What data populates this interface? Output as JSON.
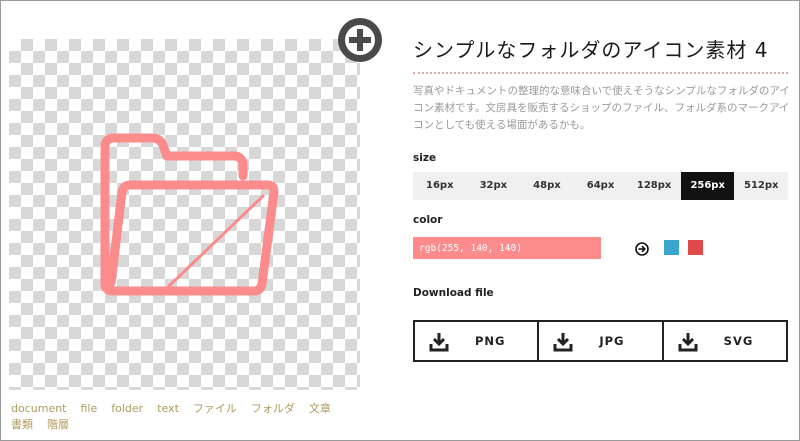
{
  "page": {
    "title": "シンプルなフォルダのアイコン素材 4",
    "description": "写真やドキュメントの整理的な意味合いで使えそうなシンプルなフォルダのアイコン素材です。文房具を販売するショップのファイル、フォルダ系のマークアイコンとしても使える場面があるかも。"
  },
  "preview": {
    "icon": "open-folder-icon",
    "icon_color": "#fc8c8c",
    "add_icon": "plus-circle-icon"
  },
  "tags": [
    "document",
    "file",
    "folder",
    "text",
    "ファイル",
    "フォルダ",
    "文章",
    "書類",
    "階層"
  ],
  "size": {
    "label": "size",
    "options": [
      "16px",
      "32px",
      "48px",
      "64px",
      "128px",
      "256px",
      "512px"
    ],
    "selected": "256px"
  },
  "color": {
    "label": "color",
    "value": "rgb(255, 140, 140)",
    "swatch_value": "#fc8c8c",
    "apply_icon": "arrow-right-circle-icon",
    "presets": [
      "#3aa6d0",
      "#dd4b4b"
    ]
  },
  "download": {
    "label": "Download file",
    "icon": "download-icon",
    "formats": [
      "PNG",
      "JPG",
      "SVG"
    ]
  }
}
